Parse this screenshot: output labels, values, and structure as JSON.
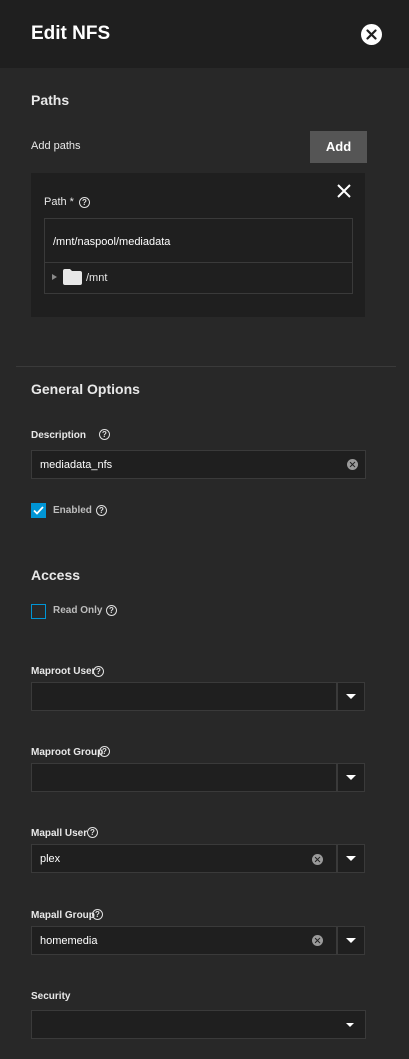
{
  "header": {
    "title": "Edit NFS"
  },
  "paths": {
    "section_title": "Paths",
    "add_paths_label": "Add paths",
    "add_button_label": "Add",
    "path_label": "Path *",
    "path_value": "/mnt/naspool/mediadata",
    "tree": {
      "root_label": "/mnt"
    }
  },
  "general": {
    "section_title": "General Options",
    "description_label": "Description",
    "description_value": "mediadata_nfs",
    "enabled_label": "Enabled",
    "enabled_checked": true
  },
  "access": {
    "section_title": "Access",
    "read_only_label": "Read Only",
    "read_only_checked": false,
    "maproot_user_label": "Maproot User",
    "maproot_user_value": "",
    "maproot_group_label": "Maproot Group",
    "maproot_group_value": "",
    "mapall_user_label": "Mapall User",
    "mapall_user_value": "plex",
    "mapall_group_label": "Mapall Group",
    "mapall_group_value": "homemedia",
    "security_label": "Security",
    "security_value": ""
  },
  "icons": {
    "help": "help-circle-icon",
    "close": "close-circle-icon",
    "remove": "close-icon",
    "folder": "folder-icon",
    "clear": "clear-icon",
    "dropdown": "chevron-down-icon"
  },
  "colors": {
    "accent": "#0095d5",
    "background": "#282828",
    "panel": "#1f1f1f",
    "button": "#555555"
  }
}
